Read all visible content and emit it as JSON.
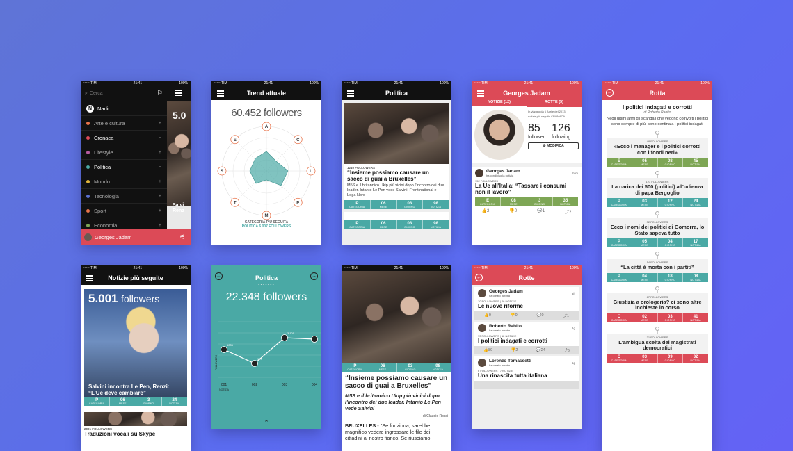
{
  "status": {
    "carrier": "••••• TIM",
    "time": "21:41",
    "battery": "100%"
  },
  "s1": {
    "search_placeholder": "Cerca",
    "nadir": "Nadir",
    "items": [
      {
        "label": "Arte e cultura",
        "sign": "+",
        "color": "#e8734a"
      },
      {
        "label": "Cronaca",
        "sign": "−",
        "color": "#dc4a57"
      },
      {
        "label": "Lifestyle",
        "sign": "+",
        "color": "#b65aa0"
      },
      {
        "label": "Politica",
        "sign": "−",
        "color": "#4aa9a5"
      },
      {
        "label": "Mondo",
        "sign": "+",
        "color": "#e0b43a"
      },
      {
        "label": "Tecnologia",
        "sign": "+",
        "color": "#5a6fd0"
      },
      {
        "label": "Sport",
        "sign": "+",
        "color": "#e8734a"
      },
      {
        "label": "Economia",
        "sign": "+",
        "color": "#7ea655"
      }
    ],
    "user": "Georges Jadam",
    "peek_number": "5.0",
    "peek_text": "Salvi Renz"
  },
  "s2": {
    "title": "Trend attuale",
    "followers": "60.452 followers",
    "axes": [
      "A",
      "C",
      "L",
      "P",
      "M",
      "T",
      "S",
      "E"
    ],
    "caption1": "CATEGORIA PIÙ SEGUITA",
    "caption2": "POLITICA 6.007 FOLLOWERS"
  },
  "s3": {
    "title": "Politica",
    "followers_count": "1210 FOLLOWERS",
    "headline": "“Insieme possiamo causare un sacco di guai a Bruxelles”",
    "body": "M5S e il britannico Ukip più vicini dopo l'incontro dei due leader. Intanto Le Pen vede Salvini: Front national e Lega Nord",
    "stats": [
      [
        "P",
        "CATEGORIA"
      ],
      [
        "06",
        "MESE"
      ],
      [
        "03",
        "GIORNO"
      ],
      [
        "98",
        "NOTIZIA"
      ]
    ]
  },
  "s4": {
    "title": "Georges Jadam",
    "tab1": "NOTIZIE (12)",
    "tab2": "ROTTE (5)",
    "since": "In viaggio da 6 Aprile del 2013",
    "most": "notizie più seguita CRONACA",
    "followers": "85",
    "followers_label": "follower",
    "following": "126",
    "following_label": "following",
    "edit": "MODIFICA",
    "post_user": "Georges Jadam",
    "post_time": "24m",
    "post_action": "ha condiviso la notizia",
    "post_count": "152 FOLLOWERS",
    "post_title": "La Ue all'Italia: “Tassare i consumi non il lavoro”",
    "post_stats": [
      [
        "E",
        "CATEGORIA"
      ],
      [
        "08",
        "MESE"
      ],
      [
        "3",
        "GIORNO"
      ],
      [
        "35",
        "NOTIZIA"
      ]
    ],
    "actions": [
      "2",
      "0",
      "1",
      "2"
    ]
  },
  "s5": {
    "title": "Rotta",
    "route_title": "I politici indagati e corrotti",
    "author": "di Roberto Rabito",
    "intro": "Negli ultimi anni gli scandali che vedono coinvolti i politici sono sempre di più, sono centinaia i politici indagati",
    "cards": [
      {
        "count": "48 FOLLOWERS",
        "title": "«Ecco i manager e i politici corrotti con i fondi neri»",
        "cat": "E",
        "m": "05",
        "g": "08",
        "n": "45",
        "color": "c-green"
      },
      {
        "count": "123 FOLLOWERS",
        "title": "La carica dei 500 (politici) all'udienza di papa Bergoglio",
        "cat": "P",
        "m": "03",
        "g": "12",
        "n": "24",
        "color": "c-teal"
      },
      {
        "count": "32 FOLLOWERS",
        "title": "Ecco i nomi dei politici di Gomorra, lo Stato sapeva tutto",
        "cat": "P",
        "m": "05",
        "g": "04",
        "n": "17",
        "color": "c-teal"
      },
      {
        "count": "14 FOLLOWERS",
        "title": "“La città è morta con i partiti”",
        "cat": "P",
        "m": "04",
        "g": "18",
        "n": "08",
        "color": "c-teal"
      },
      {
        "count": "67 FOLLOWERS",
        "title": "Giustizia a orologeria? ci sono altre inchieste in corso",
        "cat": "C",
        "m": "02",
        "g": "03",
        "n": "41",
        "color": "c-red"
      },
      {
        "count": "31 FOLLOWERS",
        "title": "L'ambigua scelta dei magistrati democratici",
        "cat": "C",
        "m": "03",
        "g": "09",
        "n": "32",
        "color": "c-red"
      }
    ]
  },
  "s6": {
    "title": "Notizie più seguite",
    "followers_num": "5.001",
    "followers_word": "followers",
    "headline": "Salvini incontra Le Pen, Renzi: “L'Ue deve cambiare”",
    "stats": [
      [
        "P",
        "CATEGORIA"
      ],
      [
        "06",
        "MESE"
      ],
      [
        "3",
        "GIORNO"
      ],
      [
        "24",
        "NOTIZIA"
      ]
    ],
    "count2": "2001 FOLLOWERS",
    "headline2": "Traduzioni vocali su Skype"
  },
  "s7": {
    "title": "Politica",
    "followers": "22.348 followers",
    "x_labels": [
      "001",
      "002",
      "003",
      "004"
    ],
    "x_sub": "NOTIZIA",
    "y_label": "FOLLOWERS",
    "point_labels": [
      "1005",
      "109",
      "3.105",
      ""
    ]
  },
  "s8": {
    "stats": [
      [
        "P",
        "CATEGORIA"
      ],
      [
        "06",
        "MESE"
      ],
      [
        "03",
        "GIORNO"
      ],
      [
        "98",
        "NOTIZIA"
      ]
    ],
    "headline": "“Insieme possiamo causare un sacco di guai a Bruxelles”",
    "lead": "M5S e il britannico Ukip più vicini dopo l'incontro dei due leader. Intanto Le Pen vede Salvini",
    "byline": "di Claudio Rossi",
    "body_lead": "BRUXELLES",
    "body": " - \"Se funziona, sarebbe magnifico vedere ingrossare le file dei cittadini al nostro fianco. Se riusciamo"
  },
  "s9": {
    "title": "Rotte",
    "posts": [
      {
        "user": "Georges Jadam",
        "action": "ha creato la rotta",
        "time": "3h",
        "meta": "10 FOLLOWERS | 26 NOTIZIE",
        "title": "Le nuove riforme",
        "acts": [
          "0",
          "0",
          "0",
          "1"
        ]
      },
      {
        "user": "Roberto Rabito",
        "action": "ha creato la rotta",
        "time": "1g",
        "meta": "73 FOLLOWERS | 12 NOTIZIE",
        "title": "I politici indagati e corrotti",
        "acts": [
          "89",
          "2",
          "24",
          "6"
        ]
      },
      {
        "user": "Lorenzo Tomassetti",
        "action": "ha creato la rotta",
        "time": "5g",
        "meta": "6 FOLLOWERS | 7 NOTIZIE",
        "title": "Una rinascita tutta italiana",
        "acts": []
      }
    ]
  }
}
